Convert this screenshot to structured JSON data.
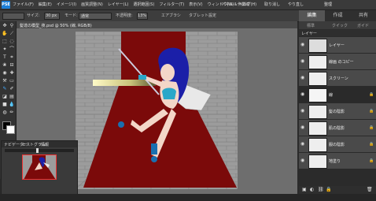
{
  "menubar": {
    "logo": "PSE",
    "menus": [
      "ファイル(F)",
      "編集(E)",
      "イメージ(I)",
      "画質調整(N)",
      "レイヤー(L)",
      "選択範囲(S)",
      "フィルター(T)",
      "表示(V)",
      "ウィンドウ(W)",
      "ヘルプ(H)"
    ],
    "right_items": [
      "パネル＆作業域",
      "取り消し",
      "やり直し",
      "整理"
    ]
  },
  "optbar": {
    "size_label": "サイズ:",
    "size_value": "30 px",
    "mode_label": "モード:",
    "mode_value": "通常",
    "opacity_label": "不透明度:",
    "opacity_value": "13%",
    "airbrush": "エアブラシ",
    "tablet": "タブレット設定"
  },
  "right_tabs": [
    "編集",
    "作成",
    "共有"
  ],
  "right_subtabs": [
    "標準",
    "クイック",
    "ガイド"
  ],
  "document_tab": "髪達の模型_夜.psd @ 50% (線, RGB/8)",
  "layers": {
    "header": "レイヤー",
    "items": [
      {
        "name": "レイヤー"
      },
      {
        "name": "線画 のコピー"
      },
      {
        "name": "スクリーン"
      },
      {
        "name": "線",
        "selected": true
      },
      {
        "name": "髪の陰影"
      },
      {
        "name": "肌の陰影"
      },
      {
        "name": "服の陰影"
      },
      {
        "name": "地塗り"
      }
    ]
  },
  "navigator": {
    "tabs": [
      "ナビゲーター",
      "ヒストグラム",
      "情報"
    ],
    "zoom": "50%"
  },
  "colors": {
    "carpet": "#7b0a0a",
    "hair": "#1b1fa8",
    "skin": "#f3d6c8",
    "accent": "#1c7ed6"
  }
}
